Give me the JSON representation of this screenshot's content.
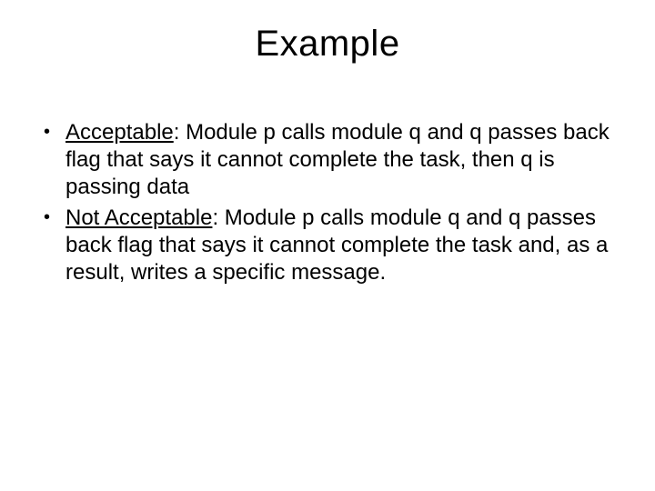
{
  "slide": {
    "title": "Example",
    "bullets": [
      {
        "lead": "Acceptable",
        "rest": ": Module p calls module q and q passes back flag that says it cannot complete the task, then q is passing data"
      },
      {
        "lead": "Not Acceptable",
        "rest": ": Module p calls module q and q passes back flag that says it cannot complete the task and, as a result, writes a specific message."
      }
    ]
  }
}
